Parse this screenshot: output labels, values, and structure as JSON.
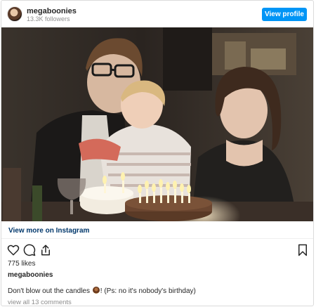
{
  "post": {
    "username": "megaboonies",
    "followers": "13.3K followers",
    "view_profile": "View profile",
    "photo_alt_icon": "photo",
    "view_more": "View more on Instagram",
    "likes": "775 likes",
    "caption_user": "megaboonies",
    "caption_before": "Don't blow out the candles",
    "caption_emoji": "cake-emoji",
    "caption_after": "! (Ps: no it's nobody's birthday)",
    "comments": "view all 13 comments"
  },
  "icons": [
    "heart-icon",
    "comment-icon",
    "share-icon",
    "bookmark-icon"
  ],
  "colors": {
    "accent": "#0095f6",
    "link": "#00376b",
    "muted": "#8e8e8e",
    "text": "#262626",
    "border": "#dbdbdb"
  }
}
